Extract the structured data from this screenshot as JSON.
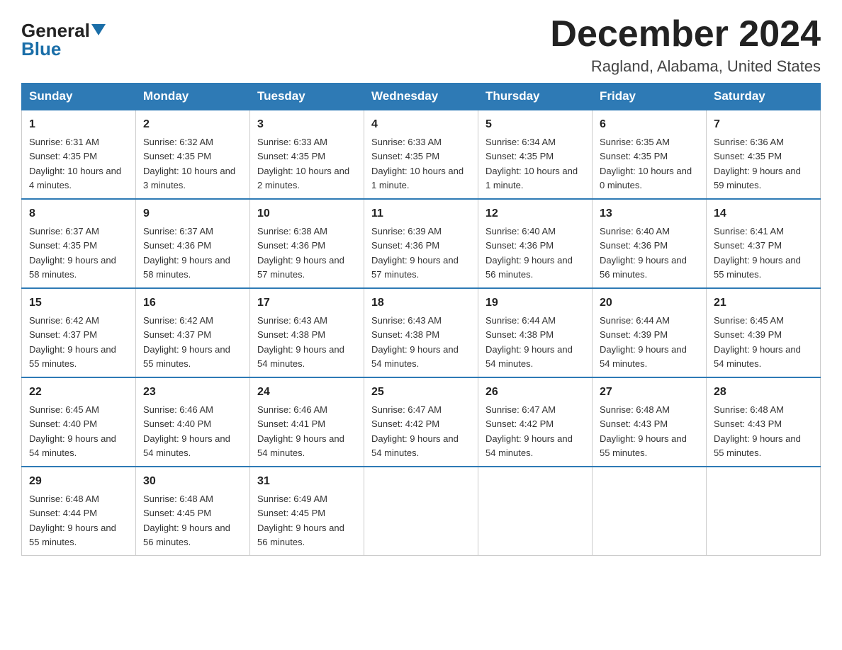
{
  "logo": {
    "general": "General",
    "blue": "Blue"
  },
  "title": "December 2024",
  "location": "Ragland, Alabama, United States",
  "weekdays": [
    "Sunday",
    "Monday",
    "Tuesday",
    "Wednesday",
    "Thursday",
    "Friday",
    "Saturday"
  ],
  "weeks": [
    [
      {
        "day": "1",
        "sunrise": "6:31 AM",
        "sunset": "4:35 PM",
        "daylight": "10 hours and 4 minutes."
      },
      {
        "day": "2",
        "sunrise": "6:32 AM",
        "sunset": "4:35 PM",
        "daylight": "10 hours and 3 minutes."
      },
      {
        "day": "3",
        "sunrise": "6:33 AM",
        "sunset": "4:35 PM",
        "daylight": "10 hours and 2 minutes."
      },
      {
        "day": "4",
        "sunrise": "6:33 AM",
        "sunset": "4:35 PM",
        "daylight": "10 hours and 1 minute."
      },
      {
        "day": "5",
        "sunrise": "6:34 AM",
        "sunset": "4:35 PM",
        "daylight": "10 hours and 1 minute."
      },
      {
        "day": "6",
        "sunrise": "6:35 AM",
        "sunset": "4:35 PM",
        "daylight": "10 hours and 0 minutes."
      },
      {
        "day": "7",
        "sunrise": "6:36 AM",
        "sunset": "4:35 PM",
        "daylight": "9 hours and 59 minutes."
      }
    ],
    [
      {
        "day": "8",
        "sunrise": "6:37 AM",
        "sunset": "4:35 PM",
        "daylight": "9 hours and 58 minutes."
      },
      {
        "day": "9",
        "sunrise": "6:37 AM",
        "sunset": "4:36 PM",
        "daylight": "9 hours and 58 minutes."
      },
      {
        "day": "10",
        "sunrise": "6:38 AM",
        "sunset": "4:36 PM",
        "daylight": "9 hours and 57 minutes."
      },
      {
        "day": "11",
        "sunrise": "6:39 AM",
        "sunset": "4:36 PM",
        "daylight": "9 hours and 57 minutes."
      },
      {
        "day": "12",
        "sunrise": "6:40 AM",
        "sunset": "4:36 PM",
        "daylight": "9 hours and 56 minutes."
      },
      {
        "day": "13",
        "sunrise": "6:40 AM",
        "sunset": "4:36 PM",
        "daylight": "9 hours and 56 minutes."
      },
      {
        "day": "14",
        "sunrise": "6:41 AM",
        "sunset": "4:37 PM",
        "daylight": "9 hours and 55 minutes."
      }
    ],
    [
      {
        "day": "15",
        "sunrise": "6:42 AM",
        "sunset": "4:37 PM",
        "daylight": "9 hours and 55 minutes."
      },
      {
        "day": "16",
        "sunrise": "6:42 AM",
        "sunset": "4:37 PM",
        "daylight": "9 hours and 55 minutes."
      },
      {
        "day": "17",
        "sunrise": "6:43 AM",
        "sunset": "4:38 PM",
        "daylight": "9 hours and 54 minutes."
      },
      {
        "day": "18",
        "sunrise": "6:43 AM",
        "sunset": "4:38 PM",
        "daylight": "9 hours and 54 minutes."
      },
      {
        "day": "19",
        "sunrise": "6:44 AM",
        "sunset": "4:38 PM",
        "daylight": "9 hours and 54 minutes."
      },
      {
        "day": "20",
        "sunrise": "6:44 AM",
        "sunset": "4:39 PM",
        "daylight": "9 hours and 54 minutes."
      },
      {
        "day": "21",
        "sunrise": "6:45 AM",
        "sunset": "4:39 PM",
        "daylight": "9 hours and 54 minutes."
      }
    ],
    [
      {
        "day": "22",
        "sunrise": "6:45 AM",
        "sunset": "4:40 PM",
        "daylight": "9 hours and 54 minutes."
      },
      {
        "day": "23",
        "sunrise": "6:46 AM",
        "sunset": "4:40 PM",
        "daylight": "9 hours and 54 minutes."
      },
      {
        "day": "24",
        "sunrise": "6:46 AM",
        "sunset": "4:41 PM",
        "daylight": "9 hours and 54 minutes."
      },
      {
        "day": "25",
        "sunrise": "6:47 AM",
        "sunset": "4:42 PM",
        "daylight": "9 hours and 54 minutes."
      },
      {
        "day": "26",
        "sunrise": "6:47 AM",
        "sunset": "4:42 PM",
        "daylight": "9 hours and 54 minutes."
      },
      {
        "day": "27",
        "sunrise": "6:48 AM",
        "sunset": "4:43 PM",
        "daylight": "9 hours and 55 minutes."
      },
      {
        "day": "28",
        "sunrise": "6:48 AM",
        "sunset": "4:43 PM",
        "daylight": "9 hours and 55 minutes."
      }
    ],
    [
      {
        "day": "29",
        "sunrise": "6:48 AM",
        "sunset": "4:44 PM",
        "daylight": "9 hours and 55 minutes."
      },
      {
        "day": "30",
        "sunrise": "6:48 AM",
        "sunset": "4:45 PM",
        "daylight": "9 hours and 56 minutes."
      },
      {
        "day": "31",
        "sunrise": "6:49 AM",
        "sunset": "4:45 PM",
        "daylight": "9 hours and 56 minutes."
      },
      null,
      null,
      null,
      null
    ]
  ]
}
